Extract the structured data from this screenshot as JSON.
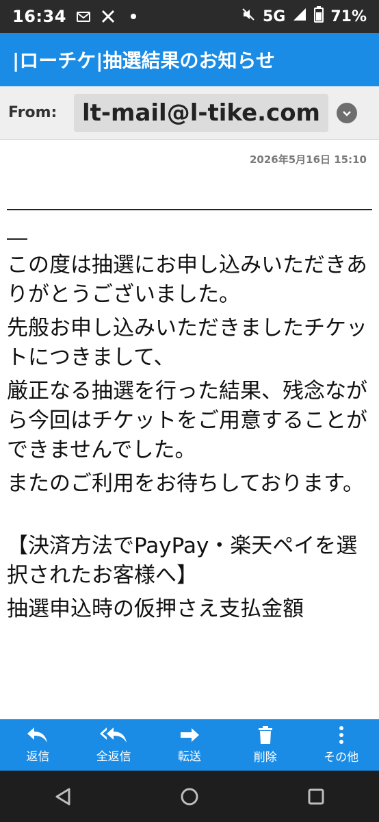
{
  "status_bar": {
    "time": "16:34",
    "network": "5G",
    "battery": "71%"
  },
  "header": {
    "subject": "|ローチケ|抽選結果のお知らせ"
  },
  "from": {
    "label": "From:",
    "address": "lt-mail@l-tike.com"
  },
  "mail": {
    "date": "2026年5月16日 15:10",
    "paragraphs": [
      "この度は抽選にお申し込みいただきありがとうございました。",
      "先般お申し込みいただきましたチケットにつきまして、",
      "厳正なる抽選を行った結果、残念ながら今回はチケットをご用意することができませんでした。",
      "またのご利用をお待ちしております。"
    ],
    "section_title": "【決済方法でPayPay・楽天ペイを選択されたお客様へ】",
    "section_text": "抽選申込時の仮押さえ支払金額"
  },
  "actions": [
    {
      "label": "返信",
      "icon": "reply-icon"
    },
    {
      "label": "全返信",
      "icon": "reply-all-icon"
    },
    {
      "label": "転送",
      "icon": "forward-icon"
    },
    {
      "label": "削除",
      "icon": "trash-icon"
    },
    {
      "label": "その他",
      "icon": "more-vertical-icon"
    }
  ],
  "colors": {
    "accent": "#1a8ce6",
    "status_bar": "#2b2b2b",
    "nav_bar": "#1e1e1e"
  }
}
